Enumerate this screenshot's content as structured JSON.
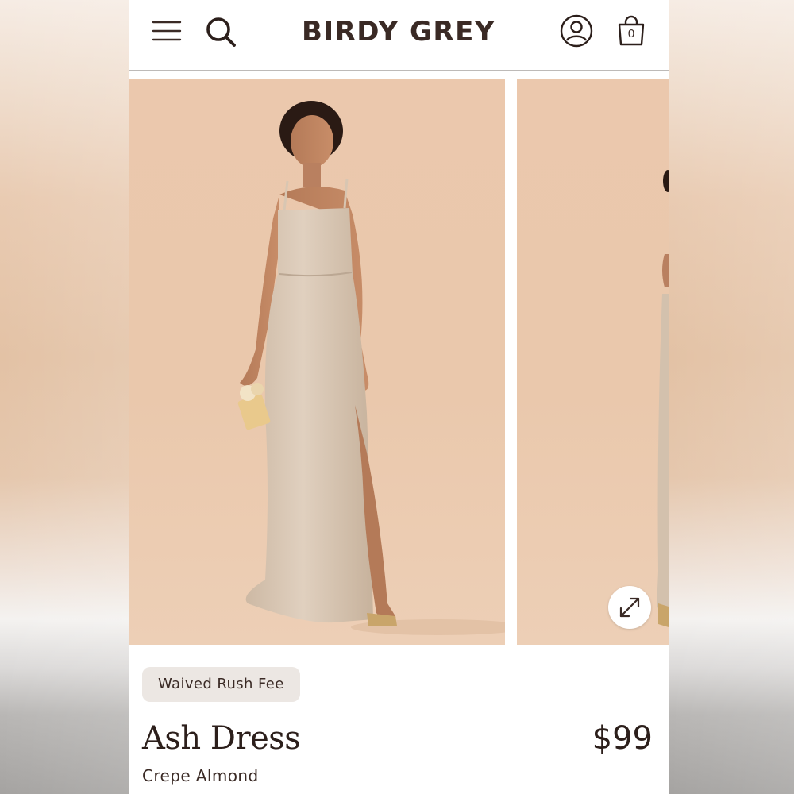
{
  "header": {
    "brand": "BIRDY GREY",
    "menu_icon": "hamburger-menu-icon",
    "search_icon": "search-icon",
    "account_icon": "account-icon",
    "bag_icon": "shopping-bag-icon",
    "bag_count": "0"
  },
  "gallery": {
    "images": [
      {
        "name": "product-image-front"
      },
      {
        "name": "product-image-side"
      }
    ],
    "expand_icon": "expand-arrows-icon"
  },
  "product": {
    "badge": "Waived Rush Fee",
    "name": "Ash Dress",
    "price": "$99",
    "color": "Crepe Almond"
  },
  "colors": {
    "text_dark": "#2c1f1b",
    "brand": "#3a2a25",
    "photo_background": "#ebc8ad",
    "dress": "#d8c6b2",
    "badge_background": "#ece7e3"
  }
}
